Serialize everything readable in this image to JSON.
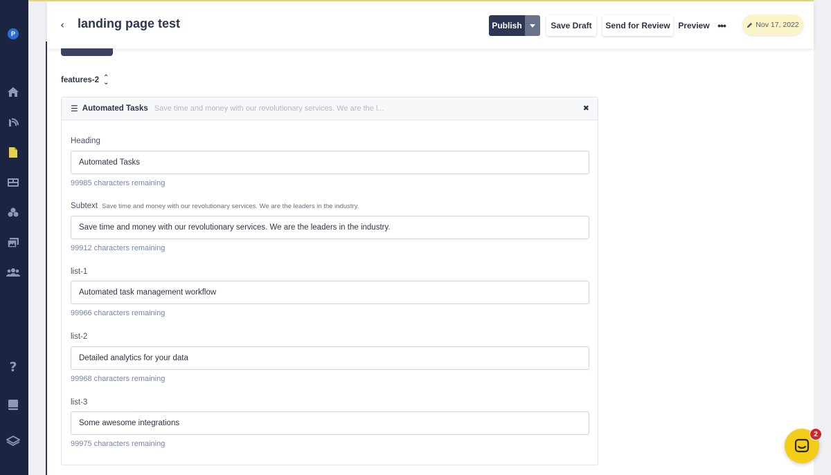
{
  "header": {
    "back_icon": "chevron-left-icon",
    "title": "landing page test",
    "publish_label": "Publish",
    "publish_dropdown_icon": "caret-down-icon",
    "save_draft_label": "Save Draft",
    "send_review_label": "Send for Review",
    "preview_label": "Preview",
    "more_icon": "ellipsis-icon",
    "more_glyph": "•••",
    "date_icon": "pencil-icon",
    "date_label": "Nov 17, 2022"
  },
  "sidebar": {
    "logo_letter": "P",
    "icons": [
      "home-icon",
      "campaign-icon",
      "pages-icon",
      "layout-icon",
      "components-icon",
      "media-icon",
      "users-icon",
      "help-icon",
      "book-icon",
      "layers-icon"
    ],
    "help_glyph": "?"
  },
  "section": {
    "name": "features-2",
    "toggle_icon": "chevron-up-down-icon"
  },
  "panel": {
    "title": "Automated Tasks",
    "subtitle": "Save time and money with our revolutionary services. We are the l...",
    "close_glyph": "✖",
    "fields": [
      {
        "label": "Heading",
        "hint": "",
        "value": "Automated Tasks",
        "remaining": "99985 characters remaining"
      },
      {
        "label": "Subtext",
        "hint": "Save time and money with our revolutionary services. We are the leaders in the industry.",
        "value": "Save time and money with our revolutionary services. We are the leaders in the industry.",
        "remaining": "99912 characters remaining"
      },
      {
        "label": "list-1",
        "hint": "",
        "value": "Automated task management workflow",
        "remaining": "99966 characters remaining"
      },
      {
        "label": "list-2",
        "hint": "",
        "value": "Detailed analytics for your data",
        "remaining": "99968 characters remaining"
      },
      {
        "label": "list-3",
        "hint": "",
        "value": "Some awesome integrations",
        "remaining": "99975 characters remaining"
      }
    ]
  },
  "chat": {
    "icon": "chat-icon",
    "badge_count": "2"
  },
  "colors": {
    "sidebar_bg": "#1b2440",
    "primary": "#2d3652",
    "accent_yellow": "#f4cd19",
    "date_pill_bg": "#fbf4c6",
    "remaining_text": "#7485a8",
    "badge_red": "#d0262c"
  }
}
